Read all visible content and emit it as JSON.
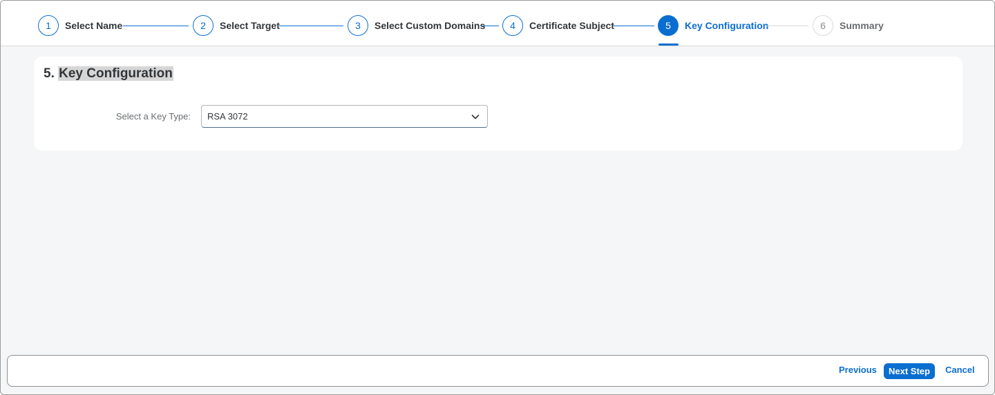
{
  "colors": {
    "accent": "#0a6ed1",
    "pending": "#d9d9d9",
    "text": "#32363a",
    "muted": "#6a6d70"
  },
  "wizard": {
    "steps": [
      {
        "number": "1",
        "label": "Select Name",
        "state": "completed"
      },
      {
        "number": "2",
        "label": "Select Target",
        "state": "completed"
      },
      {
        "number": "3",
        "label": "Select Custom Domains",
        "state": "completed"
      },
      {
        "number": "4",
        "label": "Certificate Subject",
        "state": "completed"
      },
      {
        "number": "5",
        "label": "Key Configuration",
        "state": "current"
      },
      {
        "number": "6",
        "label": "Summary",
        "state": "pending"
      }
    ]
  },
  "section": {
    "number_prefix": "5.",
    "title": "Key Configuration"
  },
  "form": {
    "key_type_label": "Select a Key Type:",
    "key_type_value": "RSA 3072"
  },
  "footer": {
    "previous_label": "Previous",
    "next_label": "Next Step",
    "cancel_label": "Cancel"
  }
}
